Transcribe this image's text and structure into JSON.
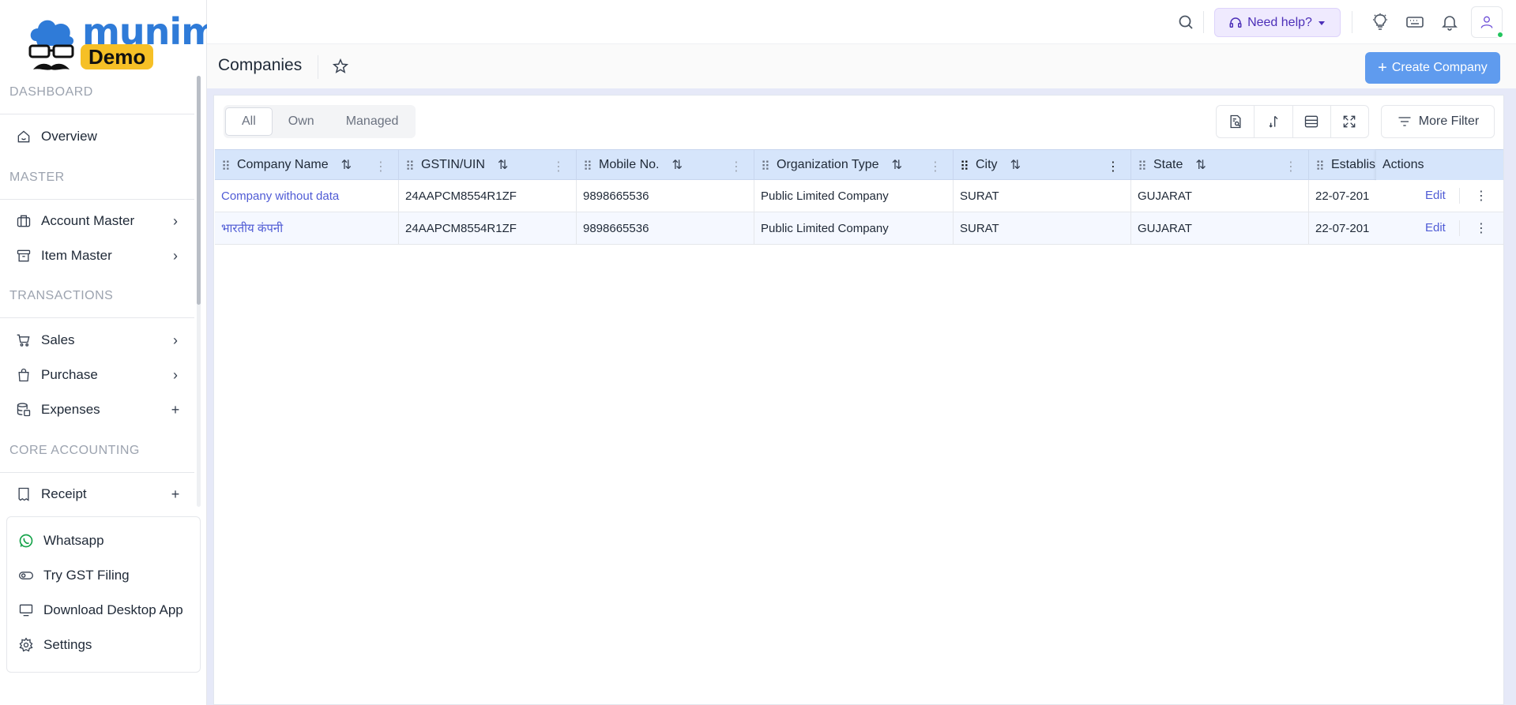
{
  "brand": {
    "word": "munim",
    "badge": "Demo"
  },
  "sidebar": {
    "sections": [
      {
        "title": "DASHBOARD"
      },
      {
        "title": "MASTER"
      },
      {
        "title": "TRANSACTIONS"
      },
      {
        "title": "CORE ACCOUNTING"
      }
    ],
    "items": [
      {
        "label": "Overview",
        "icon": "home-icon"
      },
      {
        "label": "Account Master",
        "icon": "briefcase-icon",
        "trail": "chevron-right"
      },
      {
        "label": "Item Master",
        "icon": "archive-icon",
        "trail": "chevron-right"
      },
      {
        "label": "Sales",
        "icon": "cart-icon",
        "trail": "chevron-right"
      },
      {
        "label": "Purchase",
        "icon": "bag-icon",
        "trail": "chevron-right"
      },
      {
        "label": "Expenses",
        "icon": "database-icon",
        "trail": "plus"
      },
      {
        "label": "Receipt",
        "icon": "receipt-icon",
        "trail": "plus"
      }
    ],
    "bottom": [
      {
        "label": "Whatsapp",
        "icon": "whatsapp-icon"
      },
      {
        "label": "Try GST Filing",
        "icon": "toggle-icon"
      },
      {
        "label": "Download Desktop App",
        "icon": "monitor-icon"
      },
      {
        "label": "Settings",
        "icon": "gear-icon"
      }
    ]
  },
  "topbar": {
    "help_label": "Need help?"
  },
  "page": {
    "title": "Companies",
    "create_label": "Create Company"
  },
  "tabs": [
    "All",
    "Own",
    "Managed"
  ],
  "toolbar": {
    "more_filter": "More Filter"
  },
  "table": {
    "columns": [
      "Company Name",
      "GSTIN/UIN",
      "Mobile No.",
      "Organization Type",
      "City",
      "State",
      "Establis",
      "Actions"
    ],
    "rows": [
      {
        "name": "Company without data",
        "gstin": "24AAPCM8554R1ZF",
        "mobile": "9898665536",
        "org": "Public Limited Company",
        "city": "SURAT",
        "state": "GUJARAT",
        "est": "22-07-201",
        "action": "Edit"
      },
      {
        "name": "भारतीय कंपनी",
        "gstin": "24AAPCM8554R1ZF",
        "mobile": "9898665536",
        "org": "Public Limited Company",
        "city": "SURAT",
        "state": "GUJARAT",
        "est": "22-07-201",
        "action": "Edit"
      }
    ]
  }
}
